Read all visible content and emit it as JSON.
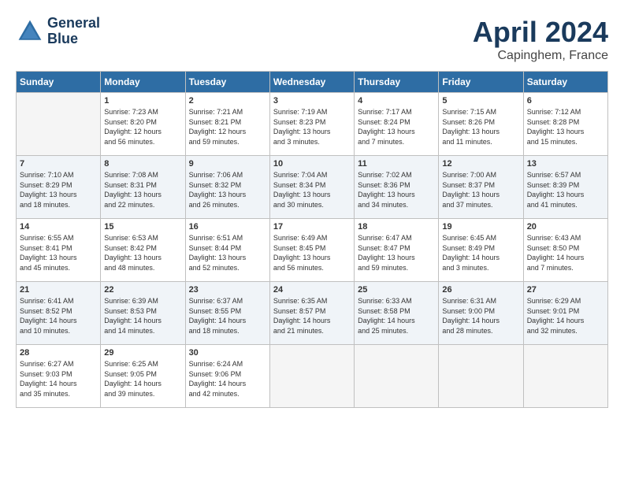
{
  "logo": {
    "line1": "General",
    "line2": "Blue"
  },
  "title": "April 2024",
  "subtitle": "Capinghem, France",
  "days_header": [
    "Sunday",
    "Monday",
    "Tuesday",
    "Wednesday",
    "Thursday",
    "Friday",
    "Saturday"
  ],
  "weeks": [
    [
      {
        "num": "",
        "info": ""
      },
      {
        "num": "1",
        "info": "Sunrise: 7:23 AM\nSunset: 8:20 PM\nDaylight: 12 hours\nand 56 minutes."
      },
      {
        "num": "2",
        "info": "Sunrise: 7:21 AM\nSunset: 8:21 PM\nDaylight: 12 hours\nand 59 minutes."
      },
      {
        "num": "3",
        "info": "Sunrise: 7:19 AM\nSunset: 8:23 PM\nDaylight: 13 hours\nand 3 minutes."
      },
      {
        "num": "4",
        "info": "Sunrise: 7:17 AM\nSunset: 8:24 PM\nDaylight: 13 hours\nand 7 minutes."
      },
      {
        "num": "5",
        "info": "Sunrise: 7:15 AM\nSunset: 8:26 PM\nDaylight: 13 hours\nand 11 minutes."
      },
      {
        "num": "6",
        "info": "Sunrise: 7:12 AM\nSunset: 8:28 PM\nDaylight: 13 hours\nand 15 minutes."
      }
    ],
    [
      {
        "num": "7",
        "info": "Sunrise: 7:10 AM\nSunset: 8:29 PM\nDaylight: 13 hours\nand 18 minutes."
      },
      {
        "num": "8",
        "info": "Sunrise: 7:08 AM\nSunset: 8:31 PM\nDaylight: 13 hours\nand 22 minutes."
      },
      {
        "num": "9",
        "info": "Sunrise: 7:06 AM\nSunset: 8:32 PM\nDaylight: 13 hours\nand 26 minutes."
      },
      {
        "num": "10",
        "info": "Sunrise: 7:04 AM\nSunset: 8:34 PM\nDaylight: 13 hours\nand 30 minutes."
      },
      {
        "num": "11",
        "info": "Sunrise: 7:02 AM\nSunset: 8:36 PM\nDaylight: 13 hours\nand 34 minutes."
      },
      {
        "num": "12",
        "info": "Sunrise: 7:00 AM\nSunset: 8:37 PM\nDaylight: 13 hours\nand 37 minutes."
      },
      {
        "num": "13",
        "info": "Sunrise: 6:57 AM\nSunset: 8:39 PM\nDaylight: 13 hours\nand 41 minutes."
      }
    ],
    [
      {
        "num": "14",
        "info": "Sunrise: 6:55 AM\nSunset: 8:41 PM\nDaylight: 13 hours\nand 45 minutes."
      },
      {
        "num": "15",
        "info": "Sunrise: 6:53 AM\nSunset: 8:42 PM\nDaylight: 13 hours\nand 48 minutes."
      },
      {
        "num": "16",
        "info": "Sunrise: 6:51 AM\nSunset: 8:44 PM\nDaylight: 13 hours\nand 52 minutes."
      },
      {
        "num": "17",
        "info": "Sunrise: 6:49 AM\nSunset: 8:45 PM\nDaylight: 13 hours\nand 56 minutes."
      },
      {
        "num": "18",
        "info": "Sunrise: 6:47 AM\nSunset: 8:47 PM\nDaylight: 13 hours\nand 59 minutes."
      },
      {
        "num": "19",
        "info": "Sunrise: 6:45 AM\nSunset: 8:49 PM\nDaylight: 14 hours\nand 3 minutes."
      },
      {
        "num": "20",
        "info": "Sunrise: 6:43 AM\nSunset: 8:50 PM\nDaylight: 14 hours\nand 7 minutes."
      }
    ],
    [
      {
        "num": "21",
        "info": "Sunrise: 6:41 AM\nSunset: 8:52 PM\nDaylight: 14 hours\nand 10 minutes."
      },
      {
        "num": "22",
        "info": "Sunrise: 6:39 AM\nSunset: 8:53 PM\nDaylight: 14 hours\nand 14 minutes."
      },
      {
        "num": "23",
        "info": "Sunrise: 6:37 AM\nSunset: 8:55 PM\nDaylight: 14 hours\nand 18 minutes."
      },
      {
        "num": "24",
        "info": "Sunrise: 6:35 AM\nSunset: 8:57 PM\nDaylight: 14 hours\nand 21 minutes."
      },
      {
        "num": "25",
        "info": "Sunrise: 6:33 AM\nSunset: 8:58 PM\nDaylight: 14 hours\nand 25 minutes."
      },
      {
        "num": "26",
        "info": "Sunrise: 6:31 AM\nSunset: 9:00 PM\nDaylight: 14 hours\nand 28 minutes."
      },
      {
        "num": "27",
        "info": "Sunrise: 6:29 AM\nSunset: 9:01 PM\nDaylight: 14 hours\nand 32 minutes."
      }
    ],
    [
      {
        "num": "28",
        "info": "Sunrise: 6:27 AM\nSunset: 9:03 PM\nDaylight: 14 hours\nand 35 minutes."
      },
      {
        "num": "29",
        "info": "Sunrise: 6:25 AM\nSunset: 9:05 PM\nDaylight: 14 hours\nand 39 minutes."
      },
      {
        "num": "30",
        "info": "Sunrise: 6:24 AM\nSunset: 9:06 PM\nDaylight: 14 hours\nand 42 minutes."
      },
      {
        "num": "",
        "info": ""
      },
      {
        "num": "",
        "info": ""
      },
      {
        "num": "",
        "info": ""
      },
      {
        "num": "",
        "info": ""
      }
    ]
  ]
}
